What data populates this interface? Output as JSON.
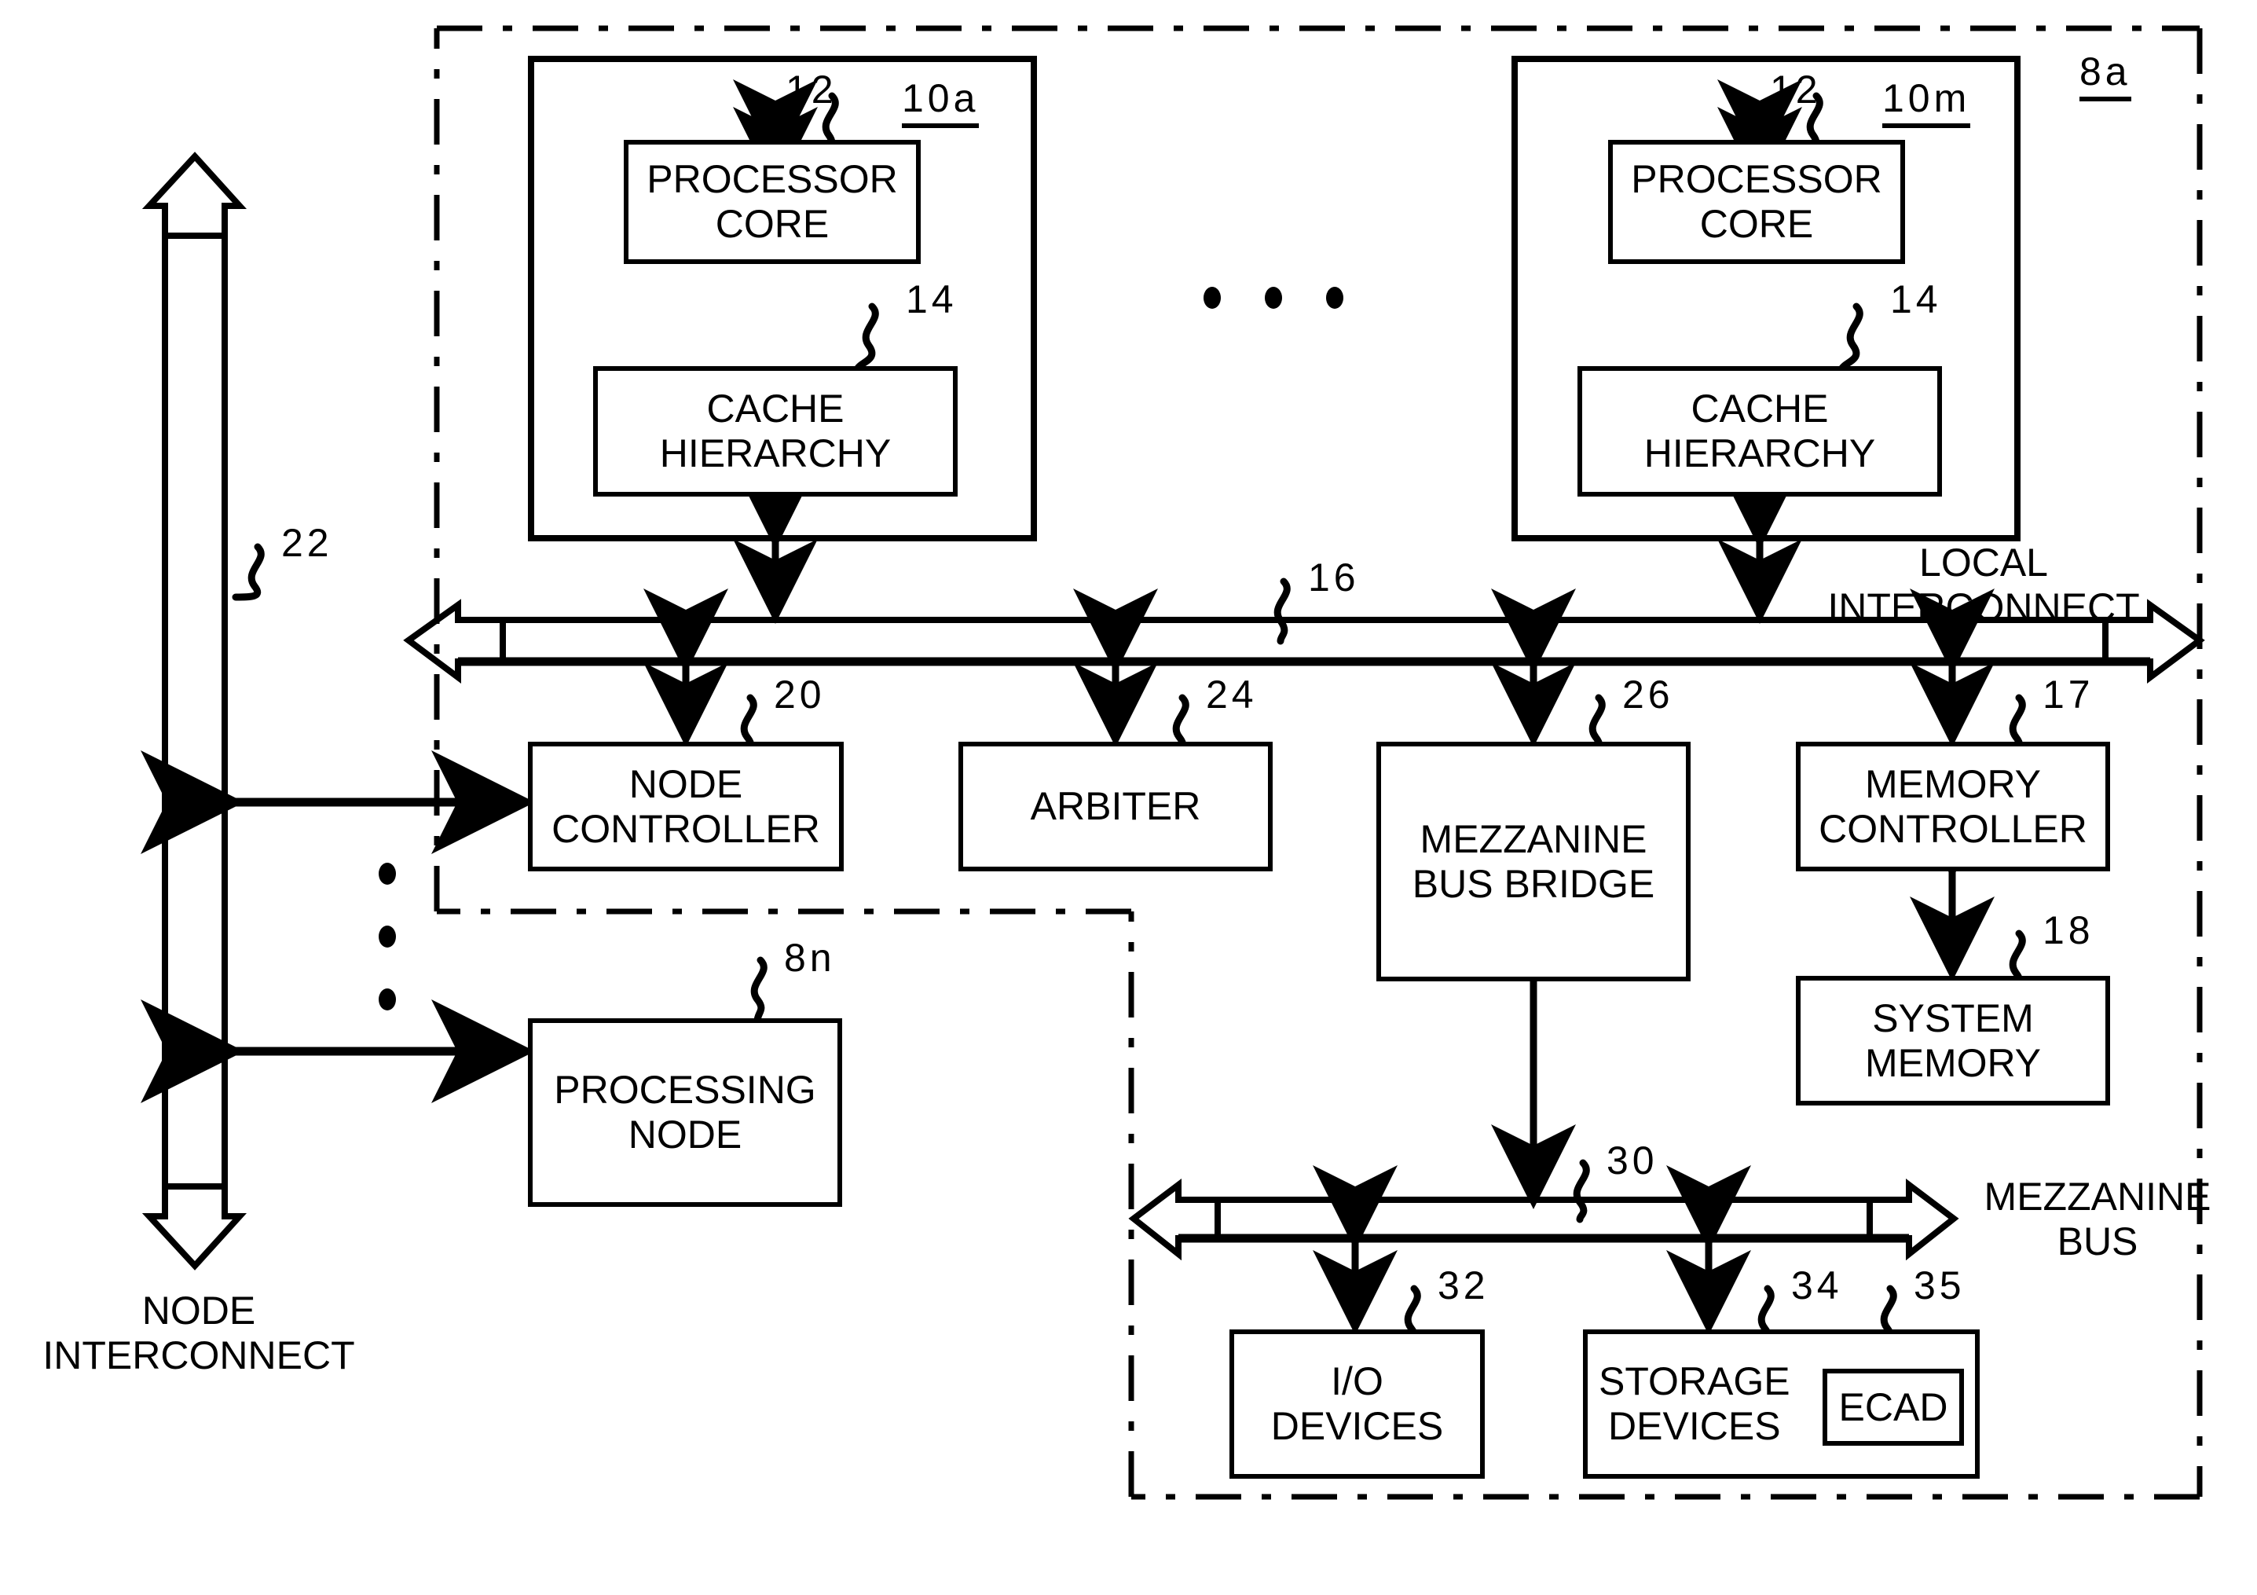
{
  "figure": {
    "type": "patent-block-diagram",
    "outer_node_ref": "8a",
    "processing_unit_left_ref": "10a",
    "processing_unit_right_ref": "10m"
  },
  "boxes": {
    "processor_core_left": {
      "lines": [
        "PROCESSOR",
        "CORE"
      ],
      "ref": "12"
    },
    "cache_hierarchy_left": {
      "lines": [
        "CACHE",
        "HIERARCHY"
      ],
      "ref": "14"
    },
    "processor_core_right": {
      "lines": [
        "PROCESSOR",
        "CORE"
      ],
      "ref": "12"
    },
    "cache_hierarchy_right": {
      "lines": [
        "CACHE",
        "HIERARCHY"
      ],
      "ref": "14"
    },
    "node_controller": {
      "lines": [
        "NODE",
        "CONTROLLER"
      ],
      "ref": "20"
    },
    "arbiter": {
      "lines": [
        "ARBITER"
      ],
      "ref": "24"
    },
    "mezzanine_bus_bridge": {
      "lines": [
        "MEZZANINE",
        "BUS BRIDGE"
      ],
      "ref": "26"
    },
    "memory_controller": {
      "lines": [
        "MEMORY",
        "CONTROLLER"
      ],
      "ref": "17"
    },
    "system_memory": {
      "lines": [
        "SYSTEM",
        "MEMORY"
      ],
      "ref": "18"
    },
    "processing_node": {
      "lines": [
        "PROCESSING",
        "NODE"
      ],
      "ref": "8n"
    },
    "io_devices": {
      "lines": [
        "I/O",
        "DEVICES"
      ],
      "ref": "32"
    },
    "storage_devices": {
      "lines": [
        "STORAGE",
        "DEVICES"
      ],
      "ref": "34"
    },
    "ecad": {
      "lines": [
        "ECAD"
      ],
      "ref": "35"
    }
  },
  "buses": {
    "local_interconnect": {
      "label_lines": [
        "LOCAL",
        "INTERCONNECT"
      ],
      "ref": "16"
    },
    "node_interconnect": {
      "label_lines": [
        "NODE",
        "INTERCONNECT"
      ],
      "ref": "22"
    },
    "mezzanine_bus": {
      "label_lines": [
        "MEZZANINE",
        "BUS"
      ],
      "ref": "30"
    }
  },
  "unit_refs": {
    "processing_unit_a": "10a",
    "processing_unit_m": "10m",
    "node_8a": "8a"
  },
  "ellipsis": {
    "horizontal_dots": 3,
    "vertical_dots": 3
  },
  "colors": {
    "ink": "#000000",
    "paper": "#ffffff"
  }
}
